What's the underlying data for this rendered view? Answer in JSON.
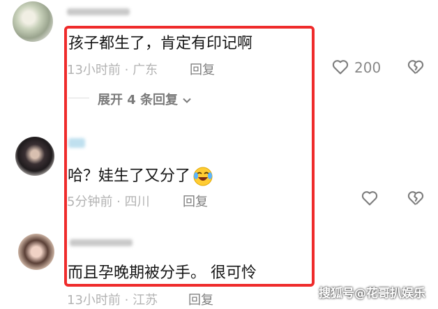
{
  "comments": [
    {
      "text": "孩子都生了，肯定有印记啊",
      "time_location": "13小时前 · 广东",
      "reply_label": "回复",
      "like_count": "200",
      "expand_label": "展开 4 条回复"
    },
    {
      "text": "哈？娃生了又分了",
      "time_location": "5分钟前 · 四川",
      "reply_label": "回复"
    },
    {
      "text": "而且孕晚期被分手。 很可怜",
      "time_location": "13小时前 · 江苏",
      "reply_label": "回复"
    }
  ],
  "watermark": "搜狐号@花哥扒娱乐",
  "colors": {
    "highlight_border": "#ef2b2b",
    "meta_text": "#b3b3b3"
  },
  "icons": [
    "heart-icon",
    "broken-heart-icon",
    "chevron-down-icon",
    "laughing-crying-emoji"
  ]
}
